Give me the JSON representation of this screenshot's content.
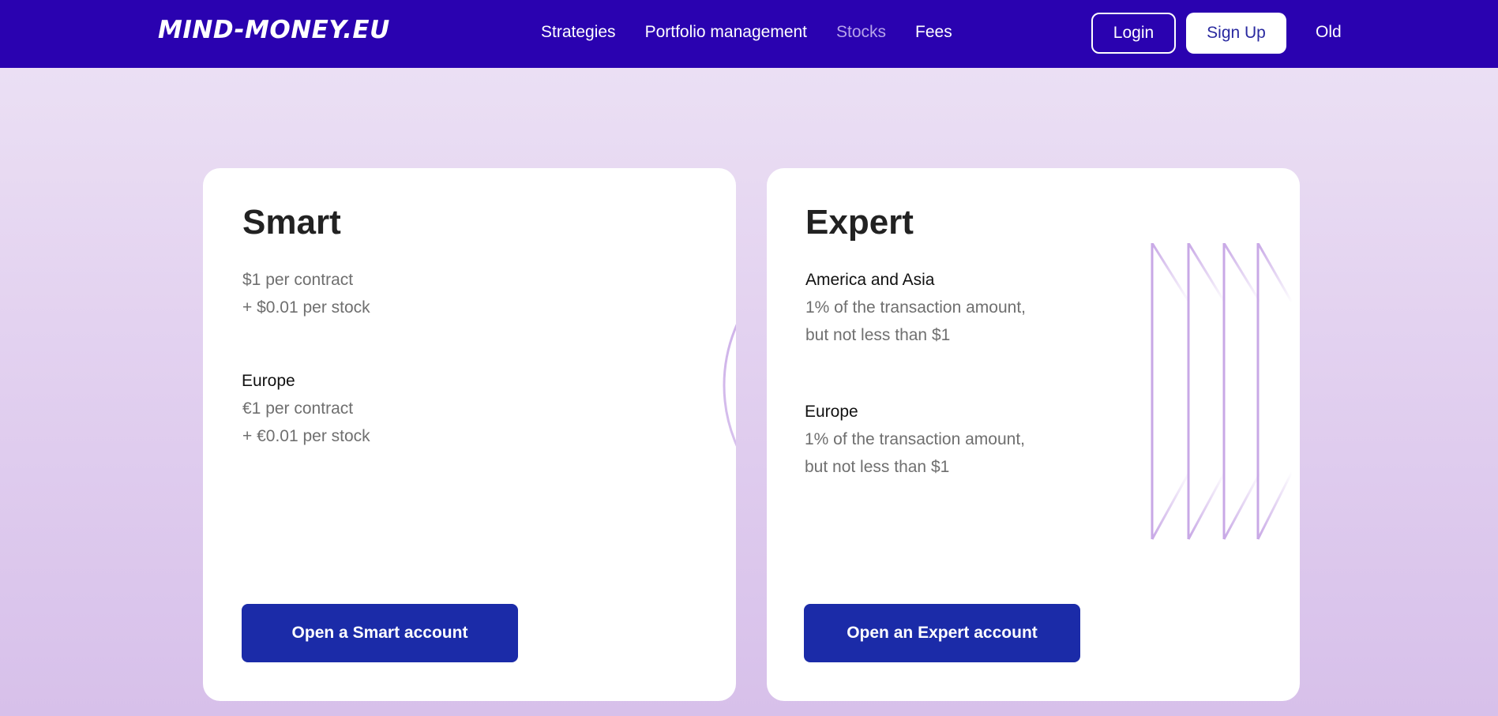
{
  "header": {
    "logo": "MIND-MONEY.EU",
    "nav": [
      {
        "label": "Strategies"
      },
      {
        "label": "Portfolio management"
      },
      {
        "label": "Stocks"
      },
      {
        "label": "Fees"
      }
    ],
    "login_label": "Login",
    "signup_label": "Sign Up",
    "old_label": "Old"
  },
  "cards": {
    "smart": {
      "title": "Smart",
      "default_lines": [
        "$1 per contract",
        "+ $0.01 per stock"
      ],
      "europe_label": "Europe",
      "europe_lines": [
        "€1 per contract",
        "+ €0.01 per stock"
      ],
      "cta": "Open a Smart account"
    },
    "expert": {
      "title": "Expert",
      "region1_label": "America and Asia",
      "region1_lines": [
        "1% of the transaction amount,",
        "but not less than $1"
      ],
      "region2_label": "Europe",
      "region2_lines": [
        "1% of the transaction amount,",
        "but not less than $1"
      ],
      "cta": "Open an Expert account"
    }
  },
  "colors": {
    "header_bg": "#2a02b0",
    "active_nav": "#b7a4ea",
    "cta_bg": "#1b2ba8",
    "deco": "#c8a8e6"
  },
  "icons": {
    "smart_decoration": "concentric-rings",
    "expert_decoration": "vertical-chevron-lines"
  }
}
